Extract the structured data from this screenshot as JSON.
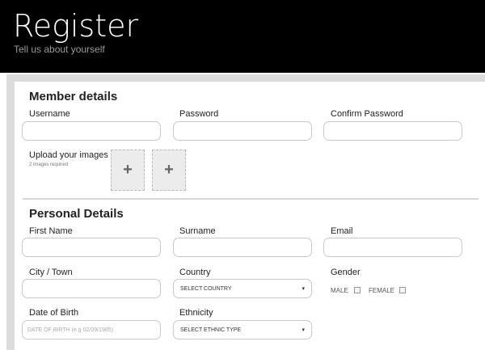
{
  "header": {
    "title": "Register",
    "subtitle": "Tell us about yourself"
  },
  "member": {
    "title": "Member details",
    "username_label": "Username",
    "password_label": "Password",
    "confirm_label": "Confirm Password",
    "upload_label": "Upload your images",
    "upload_note": "2 images required",
    "upload_plus": "+"
  },
  "personal": {
    "title": "Personal Details",
    "first_name_label": "First Name",
    "surname_label": "Surname",
    "email_label": "Email",
    "city_label": "City / Town",
    "country_label": "Country",
    "country_value": "SELECT COUNTRY",
    "gender_label": "Gender",
    "male_label": "MALE",
    "female_label": "FEMALE",
    "dob_label": "Date of Birth",
    "dob_placeholder": "DATE OF BIRTH (e.g 02/09/1985)",
    "ethnicity_label": "Ethnicity",
    "ethnicity_value": "SELECT ETHNIC TYPE",
    "caret": "▾"
  },
  "colors": {
    "hero_bg": "#000000",
    "frame_bg": "#dcdcdc",
    "field_border": "#c9c9c9"
  }
}
